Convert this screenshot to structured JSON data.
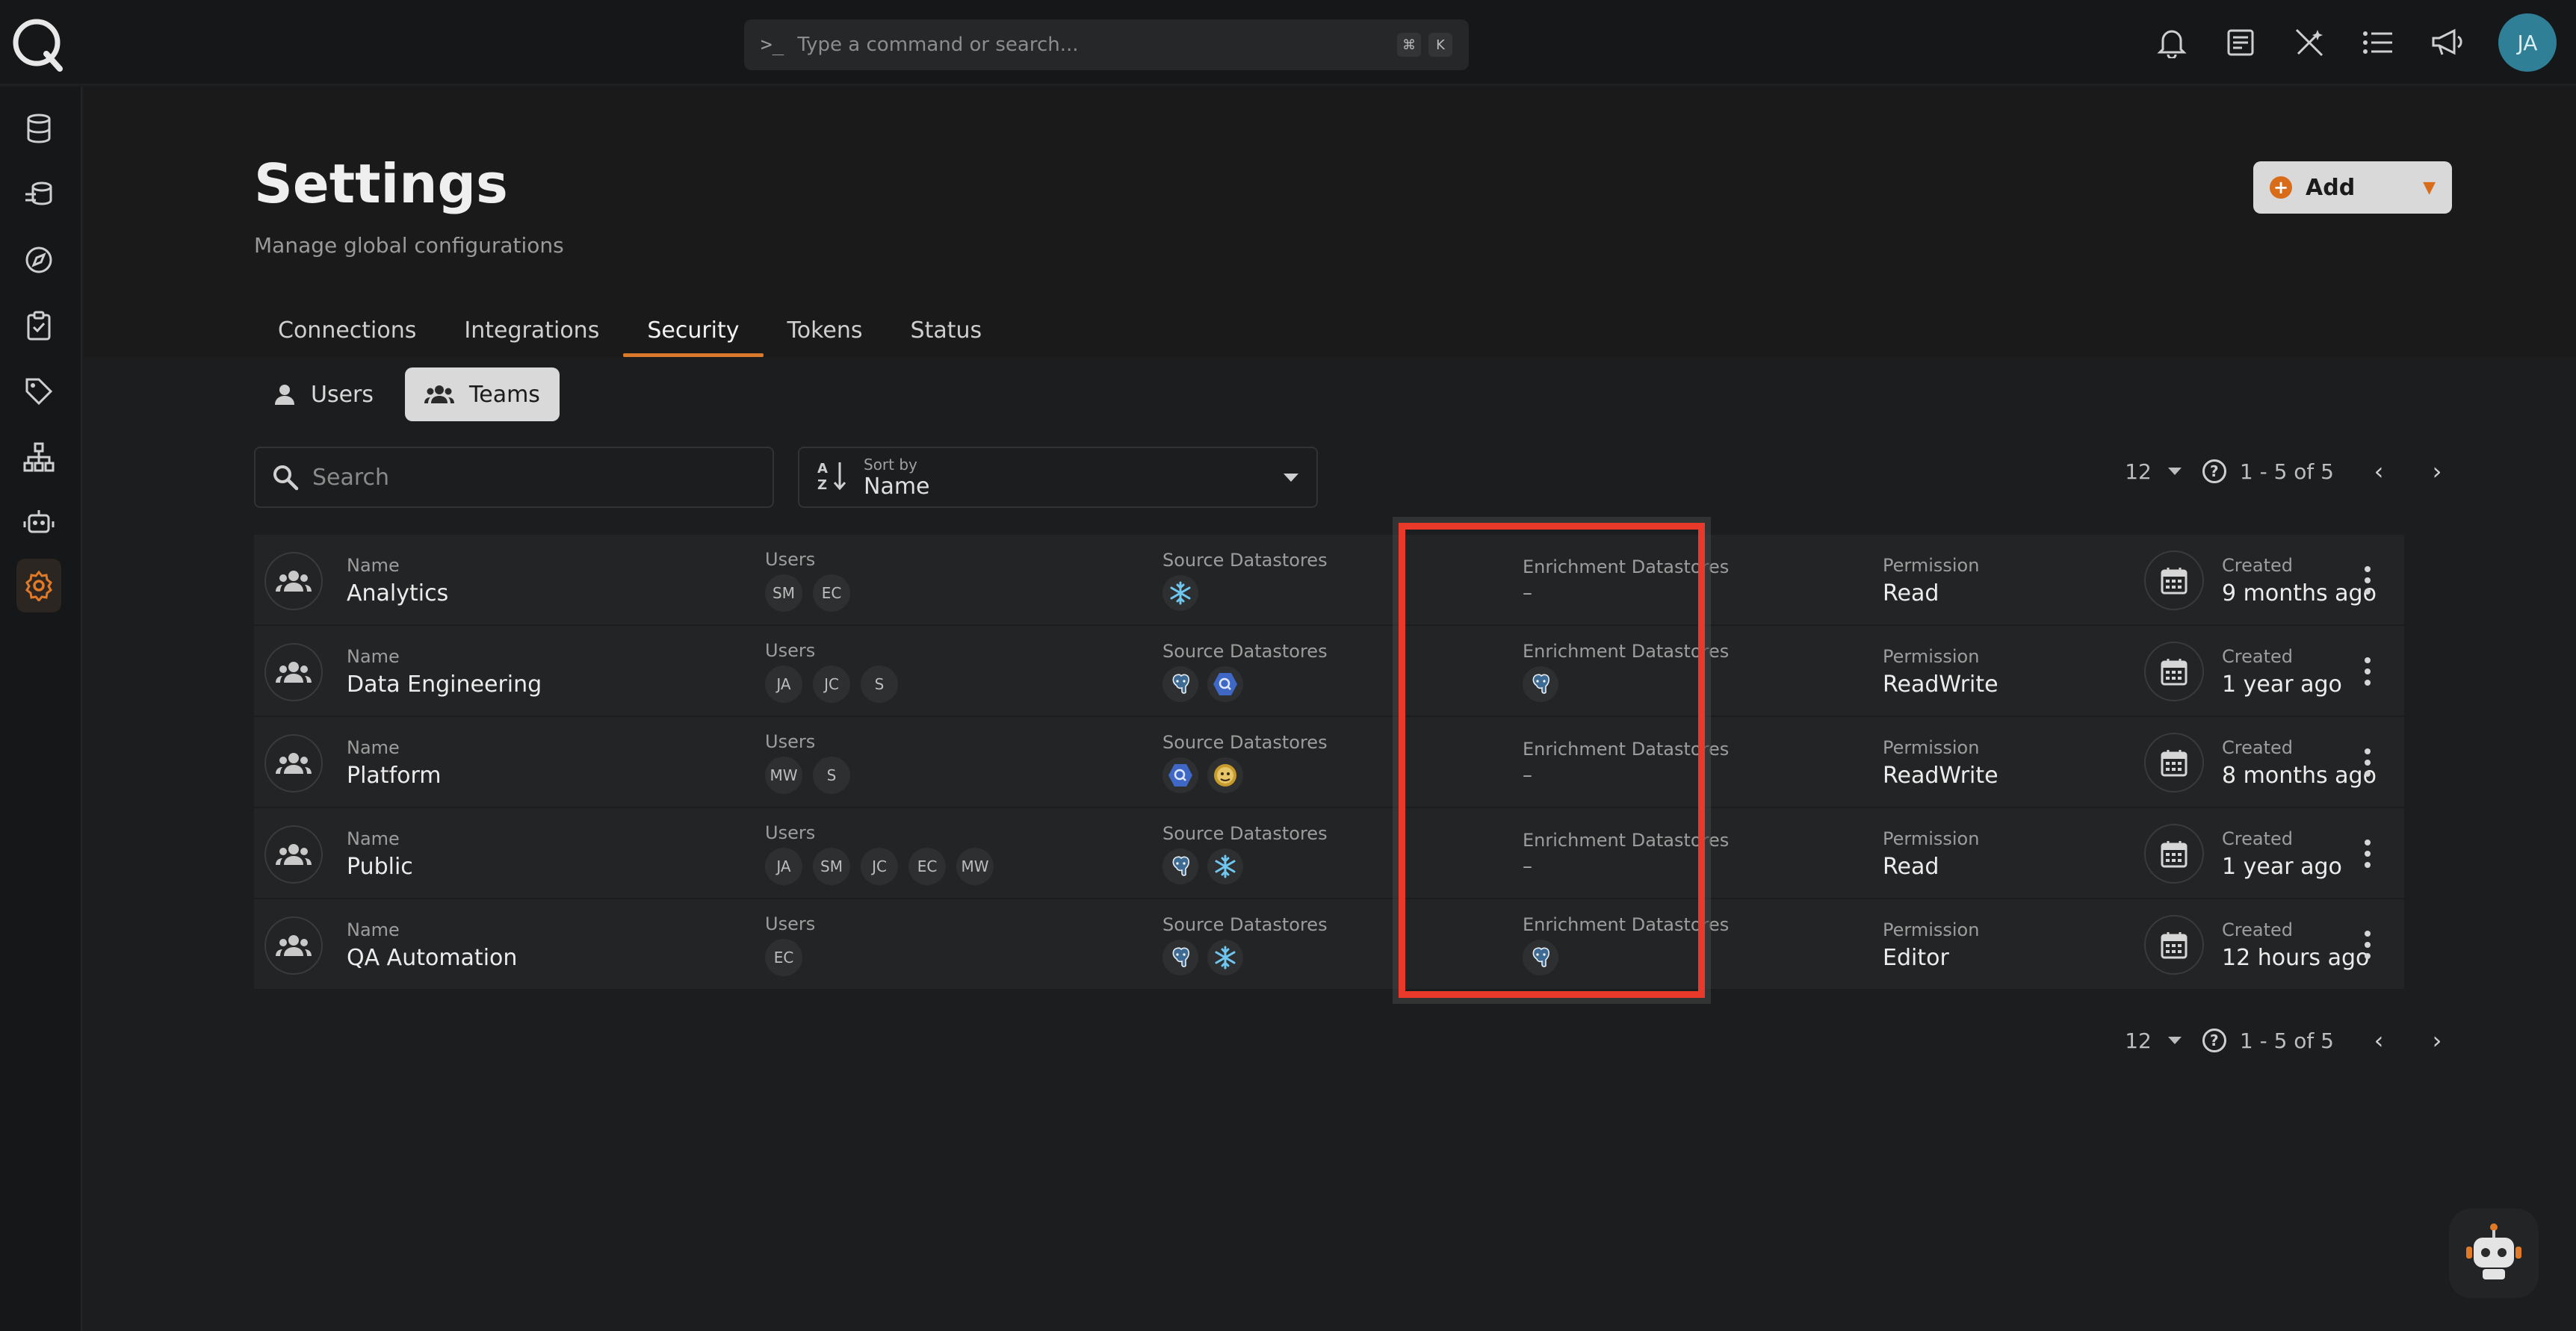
{
  "search_bar": {
    "placeholder": "Type a command or search...",
    "key1": "⌘",
    "key2": "K"
  },
  "user": {
    "initials": "JA"
  },
  "page": {
    "title": "Settings",
    "subtitle": "Manage global configurations",
    "add_label": "Add"
  },
  "tabs": [
    {
      "label": "Connections"
    },
    {
      "label": "Integrations"
    },
    {
      "label": "Security",
      "active": true
    },
    {
      "label": "Tokens"
    },
    {
      "label": "Status"
    }
  ],
  "subtabs": [
    {
      "label": "Users"
    },
    {
      "label": "Teams",
      "active": true
    }
  ],
  "filters": {
    "search_placeholder": "Search",
    "sort_label": "Sort by",
    "sort_value": "Name"
  },
  "pagination": {
    "per_page": "12",
    "range": "1 - 5 of 5"
  },
  "column_labels": {
    "name": "Name",
    "users": "Users",
    "source": "Source Datastores",
    "enrichment": "Enrichment Datastores",
    "permission": "Permission",
    "created": "Created"
  },
  "teams": [
    {
      "name": "Analytics",
      "users": [
        "SM",
        "EC"
      ],
      "source": [
        "snowflake-icon"
      ],
      "enrichment": "–",
      "permission": "Read",
      "created": "9 months ago"
    },
    {
      "name": "Data Engineering",
      "users": [
        "JA",
        "JC",
        "S"
      ],
      "source": [
        "postgres-icon",
        "bigquery-icon"
      ],
      "enrichment": [
        "postgres-icon"
      ],
      "permission": "ReadWrite",
      "created": "1 year ago"
    },
    {
      "name": "Platform",
      "users": [
        "MW",
        "S"
      ],
      "source": [
        "bigquery-icon",
        "hive-icon"
      ],
      "enrichment": "–",
      "permission": "ReadWrite",
      "created": "8 months ago"
    },
    {
      "name": "Public",
      "users": [
        "JA",
        "SM",
        "JC",
        "EC",
        "MW"
      ],
      "source": [
        "postgres-icon",
        "snowflake-icon"
      ],
      "enrichment": "–",
      "permission": "Read",
      "created": "1 year ago"
    },
    {
      "name": "QA Automation",
      "users": [
        "EC"
      ],
      "source": [
        "postgres-icon",
        "snowflake-icon"
      ],
      "enrichment": [
        "postgres-icon"
      ],
      "permission": "Editor",
      "created": "12 hours ago"
    }
  ],
  "colors": {
    "accent": "#d9792b",
    "highlight": "#e8392b"
  }
}
